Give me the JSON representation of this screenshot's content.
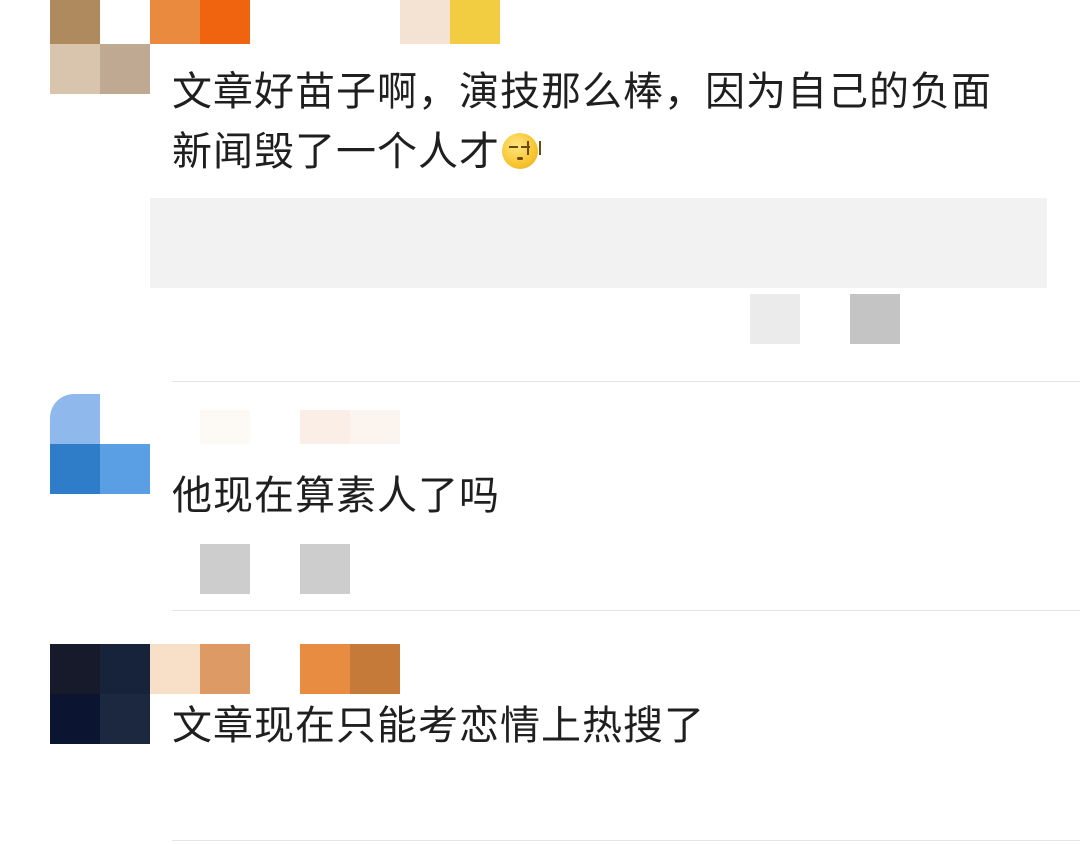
{
  "comments": [
    {
      "text": "文章好苗子啊，演技那么棒，因为自己的负面新闻毁了一个人才",
      "emoji_icon": "sweat-smile-face-icon"
    },
    {
      "text": "他现在算素人了吗"
    },
    {
      "text": "文章现在只能考恋情上热搜了"
    }
  ],
  "colors": {
    "text": "#1f1f1f",
    "divider": "#e6e6e6",
    "reply_box": "#f2f2f2"
  }
}
